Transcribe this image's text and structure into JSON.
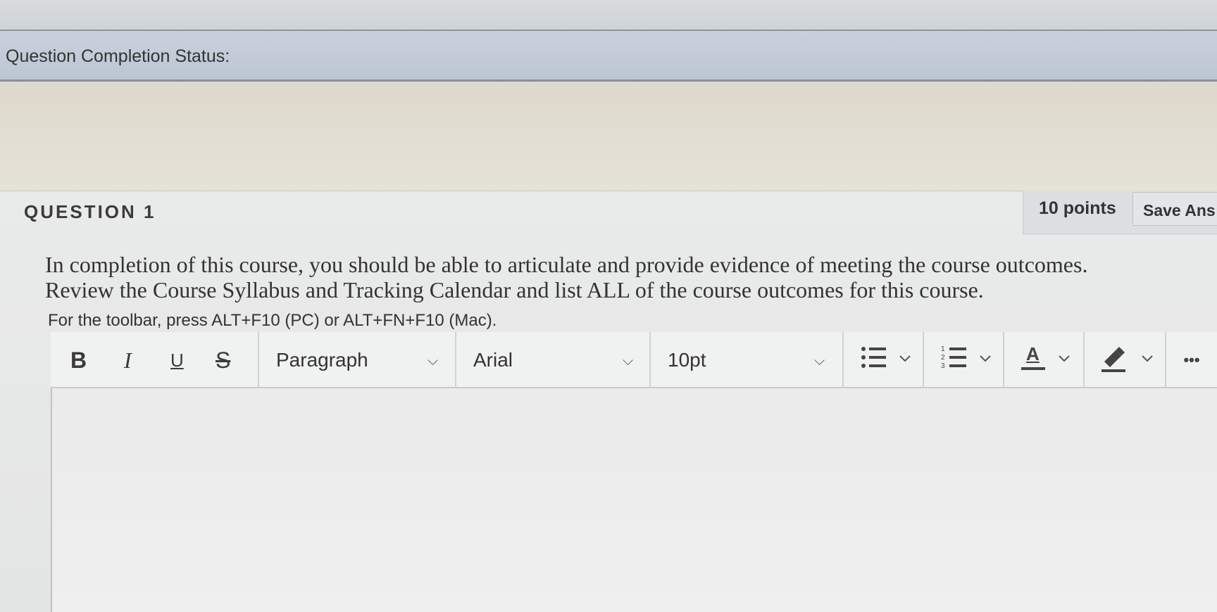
{
  "status": {
    "label": "Question Completion Status:"
  },
  "question": {
    "title": "QUESTION 1",
    "points": "10 points",
    "save_label": "Save Ans",
    "prompt_line1": "In completion of this course, you should be able to articulate and provide evidence of meeting the course outcomes.",
    "prompt_line2": "Review the Course Syllabus and Tracking Calendar and list ALL of the course outcomes for this course."
  },
  "editor": {
    "toolbar_hint": "For the toolbar, press ALT+F10 (PC) or ALT+FN+F10 (Mac).",
    "bold": "B",
    "italic": "I",
    "underline": "U",
    "strikethrough": "S",
    "block_format": "Paragraph",
    "font_family": "Arial",
    "font_size": "10pt",
    "text_color_glyph": "A",
    "more": "•••",
    "content": ""
  },
  "icons": {
    "bullet_list": "bullet-list-icon",
    "numbered_list": "numbered-list-icon",
    "text_color": "text-color-icon",
    "highlight": "highlight-icon",
    "chevron": "chevron-down-icon",
    "more": "more-options-icon"
  },
  "colors": {
    "status_bar": "#c3ccd8",
    "beige_band": "#e1ddd2",
    "panel": "#e6e7e7",
    "toolbar": "#f0f1f1"
  }
}
